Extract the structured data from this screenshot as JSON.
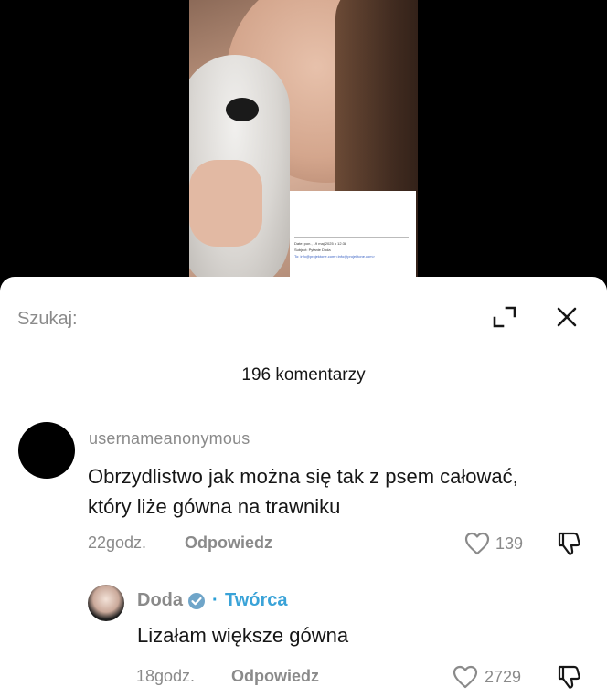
{
  "video": {
    "doc_lines": [
      "Date: pon., 19 maj 2025 o 12:38",
      "Subject: Pytanie Doda",
      "To: info@projektone.com <info@projektone.com>"
    ]
  },
  "sheet": {
    "search_label": "Szukaj:",
    "comment_count": "196 komentarzy"
  },
  "comments": [
    {
      "username": "usernameanonymous",
      "text": "Obrzydlistwo jak można się tak z psem całować, który liże gówna na trawniku",
      "time": "22godz.",
      "reply_label": "Odpowiedz",
      "likes": "139",
      "replies": [
        {
          "username": "Doda",
          "separator": "·",
          "badge": "Twórca",
          "text": "Lizałam większe gówna",
          "time": "18godz.",
          "reply_label": "Odpowiedz",
          "likes": "2729"
        }
      ]
    }
  ],
  "colors": {
    "muted_text": "#8a8a8a",
    "primary_text": "#161616",
    "creator_accent": "#3aa3d8",
    "verified_blue": "#6fa5c9"
  },
  "icons": [
    "expand-icon",
    "close-icon",
    "heart-icon",
    "dislike-icon",
    "verified-icon"
  ]
}
